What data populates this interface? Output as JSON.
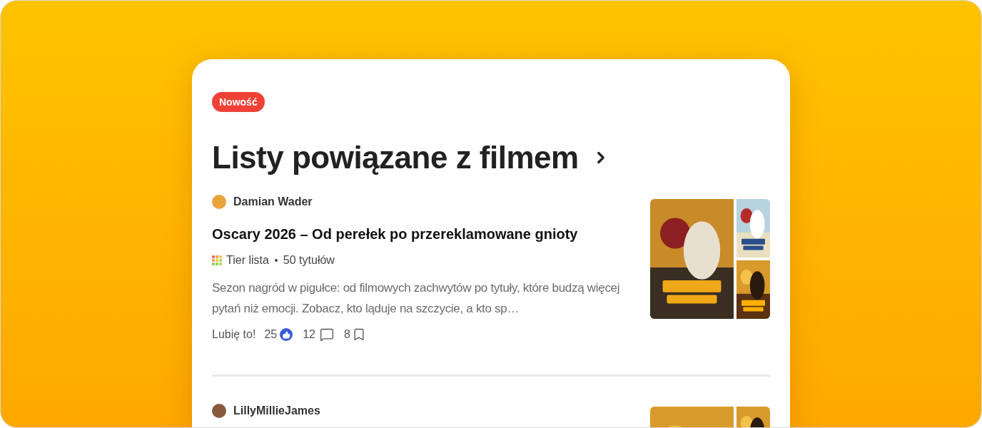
{
  "badge": "Nowość",
  "heading": "Listy powiązane z filmem",
  "lists": [
    {
      "author": "Damian Wader",
      "title": "Oscary 2026 – Od perełek po przereklamowane gnioty",
      "type": "Tier lista",
      "count": "50 tytułów",
      "description": "Sezon nagród w pigułce: od filmowych zachwytów po tytuły, które budzą więcej pytań niż emocji. Zobacz, kto ląduje na szczycie, a kto sp…",
      "like_label": "Lubię to!",
      "likes": "25",
      "comments": "12",
      "saves": "8"
    },
    {
      "author": "LillyMillieJames"
    }
  ]
}
